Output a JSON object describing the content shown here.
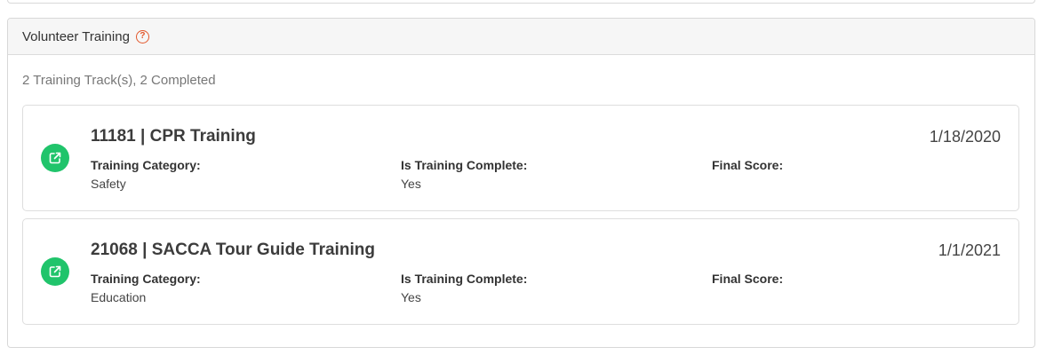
{
  "panel": {
    "title": "Volunteer Training",
    "help_icon": "question-circle-icon",
    "summary": "2 Training Track(s), 2 Completed"
  },
  "colors": {
    "accent_green": "#20c46b",
    "help_orange": "#e2572b"
  },
  "tracks": [
    {
      "title": "11181 | CPR Training",
      "date": "1/18/2020",
      "icon": "external-link-icon",
      "category_label": "Training Category:",
      "category_value": "Safety",
      "complete_label": "Is Training Complete:",
      "complete_value": "Yes",
      "score_label": "Final Score:",
      "score_value": ""
    },
    {
      "title": "21068 | SACCA Tour Guide Training",
      "date": "1/1/2021",
      "icon": "external-link-icon",
      "category_label": "Training Category:",
      "category_value": "Education",
      "complete_label": "Is Training Complete:",
      "complete_value": "Yes",
      "score_label": "Final Score:",
      "score_value": ""
    }
  ]
}
